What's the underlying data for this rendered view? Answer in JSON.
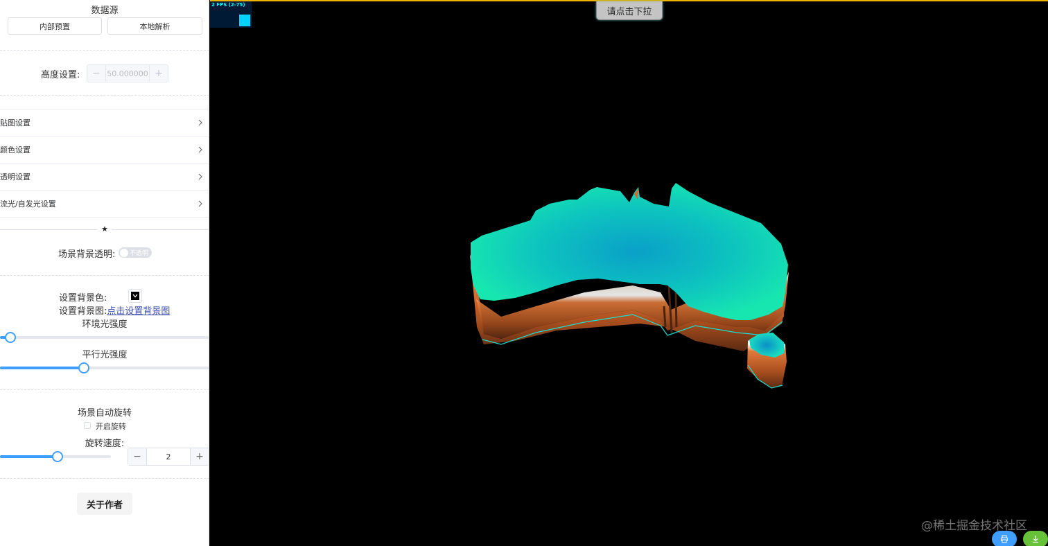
{
  "sidebar": {
    "datasource_title": "数据源",
    "datasource_buttons": [
      "内部预置",
      "本地解析"
    ],
    "height_label": "高度设置:",
    "height_value": "50.000000",
    "stepper_minus": "−",
    "stepper_plus": "+",
    "collapse_items": [
      "贴图设置",
      "颜色设置",
      "透明设置",
      "流光/自发光设置"
    ],
    "divider_symbol": "★",
    "bg_transparent_label": "场景背景透明:",
    "bg_transparent_switch": "不透明",
    "bg_color_label": "设置背景色:",
    "bg_color_value": "#000000",
    "bg_image_label": "设置背景图:",
    "bg_image_link": "点击设置背景图",
    "ambient_label": "环境光强度",
    "ambient_value": 0.05,
    "directional_label": "平行光强度",
    "directional_value": 0.4,
    "rotate_title": "场景自动旋转",
    "rotate_checkbox_label": "开启旋转",
    "rotate_checked": false,
    "rotate_speed_label": "旋转速度:",
    "rotate_speed_value": "2",
    "rotate_speed_slider": 0.52,
    "about_button": "关于作者"
  },
  "viewport": {
    "fps_text": "2 FPS (2-75)",
    "dropdown_button": "请点击下拉",
    "watermark": "@稀土掘金技术社区",
    "fab_buttons": [
      {
        "icon": "printer-icon",
        "color": "#409eff"
      },
      {
        "icon": "download-icon",
        "color": "#67c23a"
      }
    ]
  },
  "colors": {
    "accent": "#409eff",
    "map_top": "#14e3b5",
    "map_center": "#0aa4c6",
    "map_side": "#c8622a",
    "top_border": "#f0b400"
  }
}
